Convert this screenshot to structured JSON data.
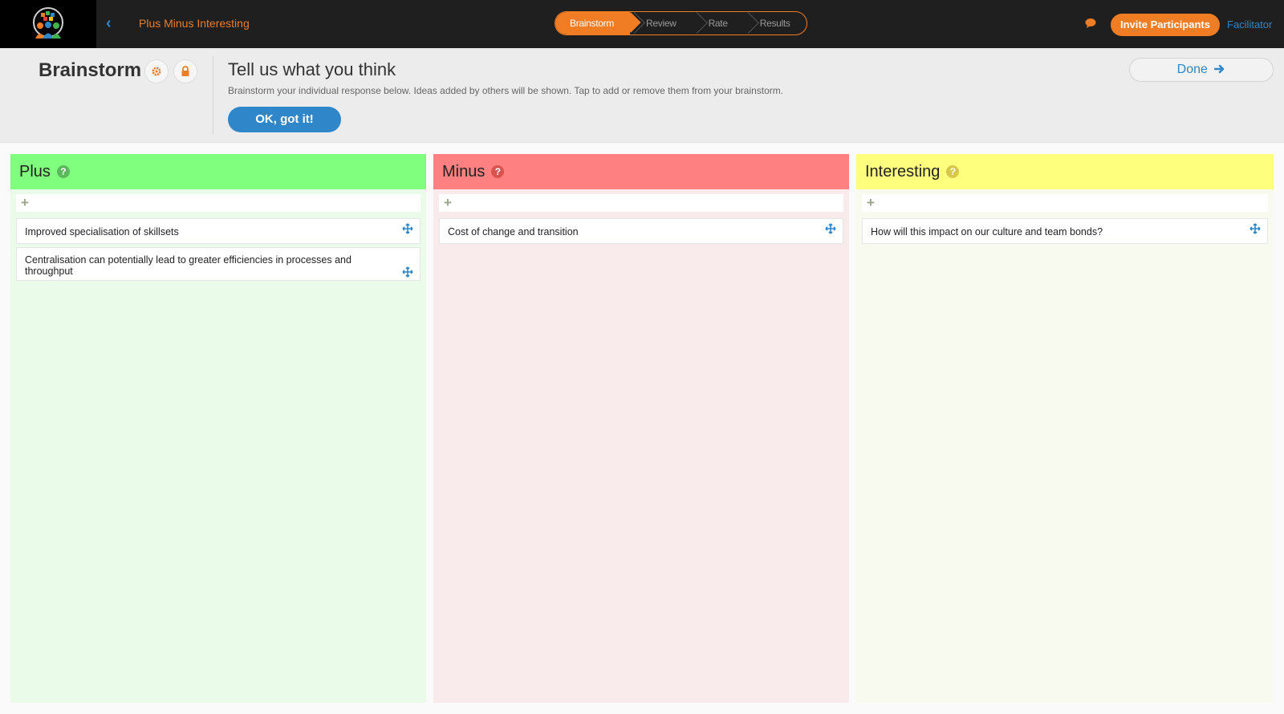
{
  "topbar": {
    "app_title": "Plus Minus Interesting",
    "steps": [
      "Brainstorm",
      "Review",
      "Rate",
      "Results"
    ],
    "invite_label": "Invite Participants",
    "facilitator_label": "Facilitator"
  },
  "header": {
    "title": "Brainstorm",
    "heading": "Tell us what you think",
    "description": "Brainstorm your individual response below. Ideas added by others will be shown. Tap to add or remove them from your brainstorm.",
    "ok_label": "OK, got it!",
    "done_label": "Done"
  },
  "colors": {
    "accent_orange": "#f07c24",
    "accent_blue": "#2f86c8",
    "plus_header": "#80ff7e",
    "minus_header": "#ff8080",
    "interesting_header": "#ffff7e"
  },
  "columns": [
    {
      "title": "Plus",
      "ideas": [
        "Improved specialisation  of skillsets",
        "Centralisation can potentially lead to greater efficiencies in processes and throughput"
      ]
    },
    {
      "title": "Minus",
      "ideas": [
        "Cost of change and transition"
      ]
    },
    {
      "title": "Interesting",
      "ideas": [
        "How will this impact on our culture and team bonds?"
      ]
    }
  ]
}
